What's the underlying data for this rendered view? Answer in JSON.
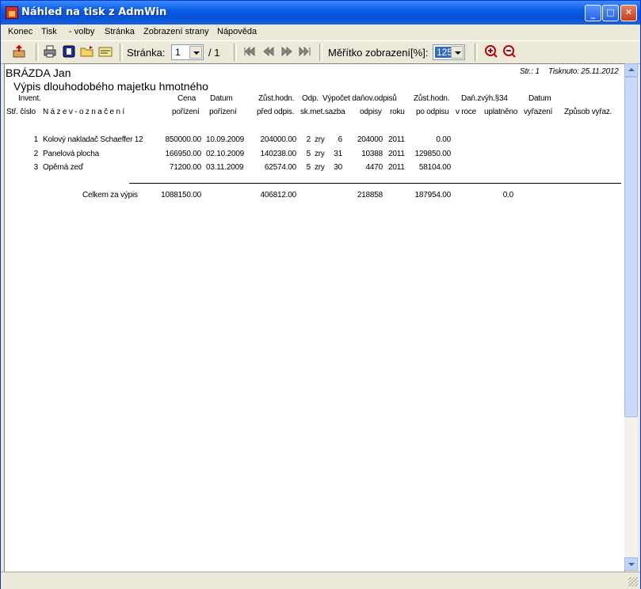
{
  "window": {
    "title": "Náhled na tisk z AdmWin"
  },
  "menu": {
    "konec": "Konec",
    "tisk": "Tisk",
    "volby": "- volby",
    "stranka": "Stránka",
    "zobrazeni": "Zobrazení strany",
    "napoveda": "Nápověda"
  },
  "toolbar": {
    "page_label": "Stránka:",
    "page_value": "1",
    "page_total": "/ 1",
    "zoom_label": "Měřítko zobrazení[%]:",
    "zoom_value": "125"
  },
  "report": {
    "person": "BRÁZDA Jan",
    "title": "Výpis dlouhodobého majetku hmotného",
    "page_info": "Str.: 1",
    "printed": "Tisknuto: 25.11.2012",
    "headers": {
      "invent": "Invent.",
      "str_cislo": "Stř. číslo",
      "nazev": "N á z e v - o z n a č e n í",
      "cena": "Cena",
      "cena2": "pořízení",
      "datum": "Datum",
      "datum2": "pořízení",
      "zust": "Zůst.hodn.",
      "zust2": "před odpis.",
      "odp": "Odp.",
      "odp2": "sk.met.sazba",
      "vypocet": "Výpočet daňov.odpisů",
      "odpisy": "odpisy",
      "roku": "roku",
      "zust_po": "Zůst.hodn.",
      "zust_po2": "po odpisu",
      "dan": "Daň.zvýh.§34",
      "vroce": "v roce",
      "uplatneno": "uplatněno",
      "vyr": "Datum",
      "vyr2": "vyřazení",
      "zpusob": "Způsob vyřaz."
    },
    "rows": [
      {
        "num": "1",
        "name": "Kolový nakladač Schaeffer 12",
        "cena": "850000.00",
        "datum": "10.09.2009",
        "zust": "204000.00",
        "sk": "2",
        "met": "zry",
        "sazba": "6",
        "odpisy": "204000",
        "roku": "2011",
        "po": "0.00"
      },
      {
        "num": "2",
        "name": "Panelová plocha",
        "cena": "166950.00",
        "datum": "02.10.2009",
        "zust": "140238.00",
        "sk": "5",
        "met": "zry",
        "sazba": "31",
        "odpisy": "10388",
        "roku": "2011",
        "po": "129850.00"
      },
      {
        "num": "3",
        "name": "Opěrná zeď",
        "cena": "71200.00",
        "datum": "03.11.2009",
        "zust": "62574.00",
        "sk": "5",
        "met": "zry",
        "sazba": "30",
        "odpisy": "4470",
        "roku": "2011",
        "po": "58104.00"
      }
    ],
    "total": {
      "label": "Celkem za  výpis",
      "cena": "1088150.00",
      "zust": "406812.00",
      "odpisy": "218858",
      "po": "187954.00",
      "dan": "0.0"
    }
  }
}
